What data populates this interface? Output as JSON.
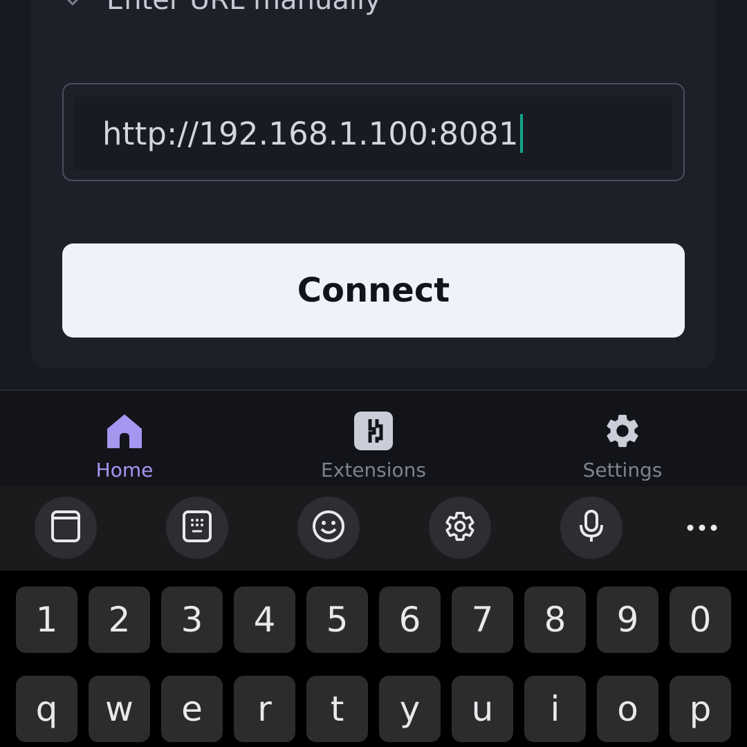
{
  "manual": {
    "label": "Enter URL manually"
  },
  "url_field": {
    "value": "http://192.168.1.100:8081"
  },
  "connect": {
    "label": "Connect"
  },
  "nav": {
    "items": [
      {
        "label": "Home",
        "icon": "home-icon",
        "active": true
      },
      {
        "label": "Extensions",
        "icon": "extensions-icon",
        "active": false
      },
      {
        "label": "Settings",
        "icon": "gear-icon",
        "active": false
      }
    ]
  },
  "keyboard_toolbar": {
    "buttons": [
      "clipboard-icon",
      "keypad-icon",
      "emoji-icon",
      "gear-icon",
      "microphone-icon",
      "more-icon"
    ]
  },
  "keyboard": {
    "row1": [
      "1",
      "2",
      "3",
      "4",
      "5",
      "6",
      "7",
      "8",
      "9",
      "0"
    ],
    "row2": [
      "q",
      "w",
      "e",
      "r",
      "t",
      "y",
      "u",
      "i",
      "o",
      "p"
    ]
  },
  "colors": {
    "accent": "#a596f0",
    "caret": "#17a589",
    "button_bg": "#eef2f9"
  }
}
